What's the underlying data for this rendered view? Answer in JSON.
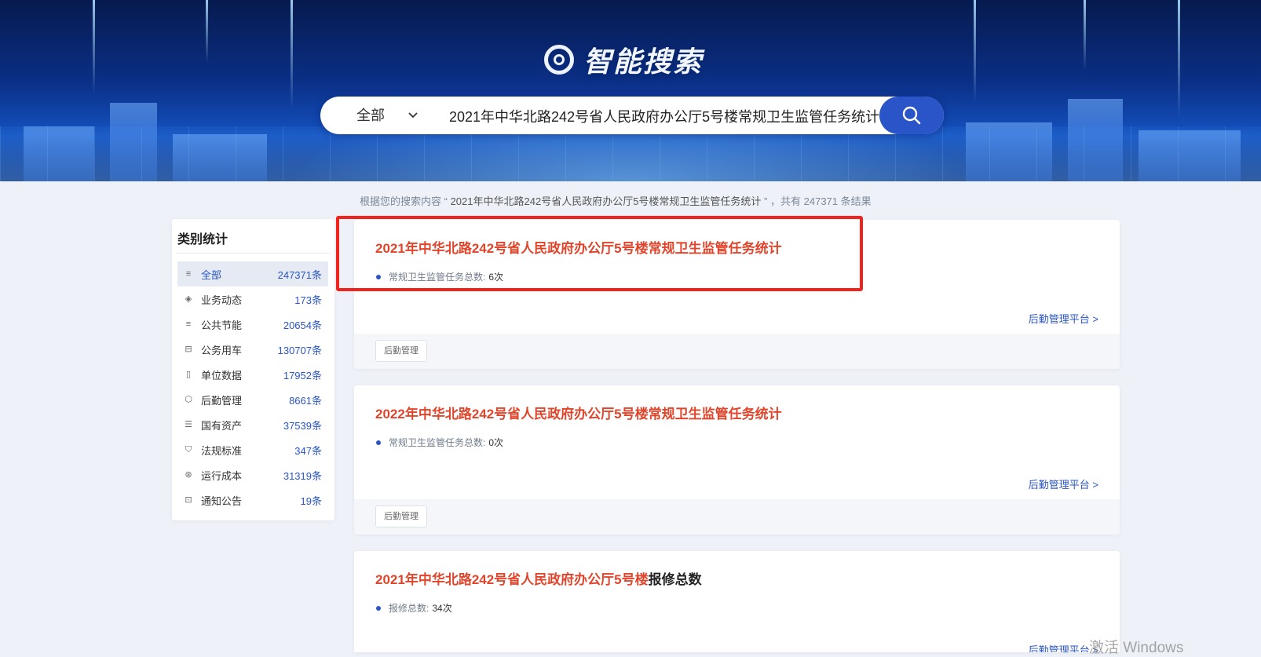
{
  "header": {
    "logo_text": "智能搜索",
    "search": {
      "category": "全部",
      "query": "2021年中华北路242号省人民政府办公厅5号楼常规卫生监管任务统计"
    }
  },
  "summary": {
    "prefix": "根据您的搜索内容 “",
    "keyword": "2021年中华北路242号省人民政府办公厅5号楼常规卫生监管任务统计",
    "middle": "” ，共有",
    "count": "247371",
    "suffix": "条结果"
  },
  "sidebar": {
    "title": "类别统计",
    "items": [
      {
        "icon": "list-icon",
        "glyph": "≡",
        "label": "全部",
        "count": "247371条",
        "active": true
      },
      {
        "icon": "layers-icon",
        "glyph": "◈",
        "label": "业务动态",
        "count": "173条"
      },
      {
        "icon": "list-icon",
        "glyph": "≡",
        "label": "公共节能",
        "count": "20654条"
      },
      {
        "icon": "car-icon",
        "glyph": "⊟",
        "label": "公务用车",
        "count": "130707条"
      },
      {
        "icon": "building-icon",
        "glyph": "▯",
        "label": "单位数据",
        "count": "17952条"
      },
      {
        "icon": "box-icon",
        "glyph": "⬡",
        "label": "后勤管理",
        "count": "8661条"
      },
      {
        "icon": "database-icon",
        "glyph": "☰",
        "label": "国有资产",
        "count": "37539条"
      },
      {
        "icon": "shield-icon",
        "glyph": "⛉",
        "label": "法规标准",
        "count": "347条"
      },
      {
        "icon": "cost-icon",
        "glyph": "⊛",
        "label": "运行成本",
        "count": "31319条"
      },
      {
        "icon": "notice-icon",
        "glyph": "⊡",
        "label": "通知公告",
        "count": "19条"
      }
    ]
  },
  "results": [
    {
      "title_hl": "2021年中华北路242号省人民政府办公厅5号楼常规卫生监管任务统计",
      "title_plain": "",
      "field_label": "常规卫生监管任务总数:",
      "field_value": "6次",
      "platform": "后勤管理平台 >",
      "tag": "后勤管理"
    },
    {
      "title_hl": "2022年中华北路242号省人民政府办公厅5号楼常规卫生监管任务统计",
      "title_plain": "",
      "field_label": "常规卫生监管任务总数:",
      "field_value": "0次",
      "platform": "后勤管理平台 >",
      "tag": "后勤管理"
    },
    {
      "title_hl": "2021年中华北路242号省人民政府办公厅5号楼",
      "title_plain": "报修总数",
      "field_label": "报修总数:",
      "field_value": "34次",
      "platform": "后勤管理平台 >",
      "tag": ""
    }
  ],
  "watermark": "激活 Windows",
  "colors": {
    "accent": "#2a55c8",
    "highlight_text": "#e0452b",
    "annotation_box": "#f0241c"
  }
}
